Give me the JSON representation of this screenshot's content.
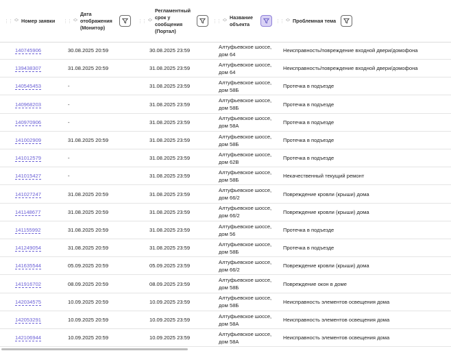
{
  "columns": [
    {
      "label": "Номер заявки"
    },
    {
      "label": "Дата отображения (Монитор)"
    },
    {
      "label": "Регламентный срок у сообщения (Портал)"
    },
    {
      "label": "Название объекта"
    },
    {
      "label": "Проблемная тема"
    }
  ],
  "rows": [
    {
      "id": "140745906",
      "date_monitor": "30.08.2025 20:59",
      "deadline": "30.08.2025 23:59",
      "object": "Алтуфьевское шоссе, дом 64",
      "topic": "Неисправность/повреждение входной двери/домофона"
    },
    {
      "id": "139438307",
      "date_monitor": "31.08.2025 20:59",
      "deadline": "31.08.2025 23:59",
      "object": "Алтуфьевское шоссе, дом 64",
      "topic": "Неисправность/повреждение входной двери/домофона"
    },
    {
      "id": "140545453",
      "date_monitor": "-",
      "deadline": "31.08.2025 23:59",
      "object": "Алтуфьевское шоссе, дом 58Б",
      "topic": "Протечка в подъезде"
    },
    {
      "id": "140968203",
      "date_monitor": "-",
      "deadline": "31.08.2025 23:59",
      "object": "Алтуфьевское шоссе, дом 58Б",
      "topic": "Протечка в подъезде"
    },
    {
      "id": "140970906",
      "date_monitor": "-",
      "deadline": "31.08.2025 23:59",
      "object": "Алтуфьевское шоссе, дом 58А",
      "topic": "Протечка в подъезде"
    },
    {
      "id": "141002909",
      "date_monitor": "31.08.2025 20:59",
      "deadline": "31.08.2025 23:59",
      "object": "Алтуфьевское шоссе, дом 58Б",
      "topic": "Протечка в подъезде"
    },
    {
      "id": "141012579",
      "date_monitor": "-",
      "deadline": "31.08.2025 23:59",
      "object": "Алтуфьевское шоссе, дом 62В",
      "topic": "Протечка в подъезде"
    },
    {
      "id": "141015427",
      "date_monitor": "-",
      "deadline": "31.08.2025 23:59",
      "object": "Алтуфьевское шоссе, дом 58Б",
      "topic": "Некачественный текущий ремонт"
    },
    {
      "id": "141027247",
      "date_monitor": "31.08.2025 20:59",
      "deadline": "31.08.2025 23:59",
      "object": "Алтуфьевское шоссе, дом 66/2",
      "topic": "Повреждение кровли (крыши) дома"
    },
    {
      "id": "141148677",
      "date_monitor": "31.08.2025 20:59",
      "deadline": "31.08.2025 23:59",
      "object": "Алтуфьевское шоссе, дом 66/2",
      "topic": "Повреждение кровли (крыши) дома"
    },
    {
      "id": "141155992",
      "date_monitor": "31.08.2025 20:59",
      "deadline": "31.08.2025 23:59",
      "object": "Алтуфьевское шоссе, дом 56",
      "topic": "Протечка в подъезде"
    },
    {
      "id": "141249054",
      "date_monitor": "31.08.2025 20:59",
      "deadline": "31.08.2025 23:59",
      "object": "Алтуфьевское шоссе, дом 58Б",
      "topic": "Протечка в подъезде"
    },
    {
      "id": "141635544",
      "date_monitor": "05.09.2025 20:59",
      "deadline": "05.09.2025 23:59",
      "object": "Алтуфьевское шоссе, дом 66/2",
      "topic": "Повреждение кровли (крыши) дома"
    },
    {
      "id": "141916702",
      "date_monitor": "08.09.2025 20:59",
      "deadline": "08.09.2025 23:59",
      "object": "Алтуфьевское шоссе, дом 58Б",
      "topic": "Повреждение окон в доме"
    },
    {
      "id": "142034575",
      "date_monitor": "10.09.2025 20:59",
      "deadline": "10.09.2025 23:59",
      "object": "Алтуфьевское шоссе, дом 58Б",
      "topic": "Неисправность элементов освещения дома"
    },
    {
      "id": "142053291",
      "date_monitor": "10.09.2025 20:59",
      "deadline": "10.09.2025 23:59",
      "object": "Алтуфьевское шоссе, дом 58А",
      "topic": "Неисправность элементов освещения дома"
    },
    {
      "id": "142106944",
      "date_monitor": "10.09.2025 20:59",
      "deadline": "10.09.2025 23:59",
      "object": "Алтуфьевское шоссе, дом 58А",
      "topic": "Неисправность элементов освещения дома"
    }
  ],
  "icons": {
    "sort": "sort-arrows-icon",
    "filter": "filter-icon",
    "drag": "drag-handle-icon"
  },
  "colors": {
    "link": "#6a5fd6",
    "filter_active_bg": "#d9d2f5",
    "border": "#e4e4e4"
  }
}
